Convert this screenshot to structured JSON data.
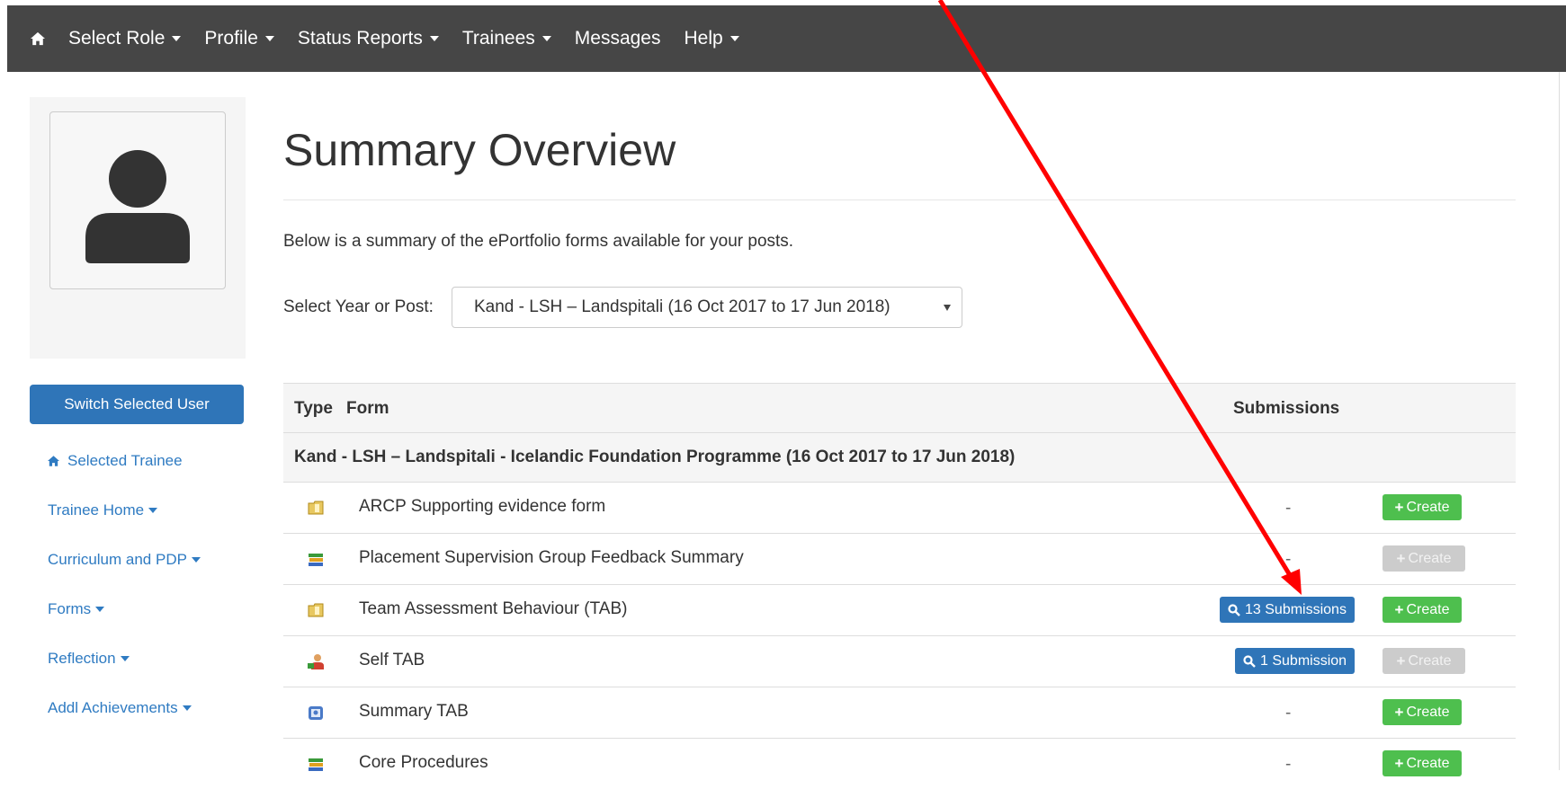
{
  "navbar": {
    "home_icon": "home-icon",
    "items": [
      {
        "label": "Select Role",
        "dropdown": true
      },
      {
        "label": "Profile",
        "dropdown": true
      },
      {
        "label": "Status Reports",
        "dropdown": true
      },
      {
        "label": "Trainees",
        "dropdown": true
      },
      {
        "label": "Messages",
        "dropdown": false
      },
      {
        "label": "Help",
        "dropdown": true
      }
    ]
  },
  "sidebar": {
    "avatar_icon": "user-silhouette-icon",
    "switch_button": "Switch Selected User",
    "selected_trainee": "Selected Trainee",
    "links": [
      {
        "label": "Trainee Home"
      },
      {
        "label": "Curriculum and PDP"
      },
      {
        "label": "Forms"
      },
      {
        "label": "Reflection"
      },
      {
        "label": "Addl Achievements"
      }
    ]
  },
  "main": {
    "title": "Summary Overview",
    "intro": "Below is a summary of the ePortfolio forms available for your posts.",
    "select_label": "Select Year or Post:",
    "select_value": "Kand - LSH – Landspitali (16 Oct 2017 to 17 Jun 2018)",
    "table": {
      "headers": {
        "type": "Type",
        "form": "Form",
        "submissions": "Submissions"
      },
      "group": "Kand - LSH – Landspitali - Icelandic Foundation Programme (16 Oct 2017 to 17 Jun 2018)",
      "rows": [
        {
          "icon": "folder-icon",
          "name": "ARCP Supporting evidence form",
          "submissions": "-",
          "create": "Create",
          "create_enabled": true
        },
        {
          "icon": "books-icon",
          "name": "Placement Supervision Group Feedback Summary",
          "submissions": "-",
          "create": "Create",
          "create_enabled": false
        },
        {
          "icon": "folder-icon",
          "name": "Team Assessment Behaviour (TAB)",
          "submissions": "13 Submissions",
          "create": "Create",
          "create_enabled": true
        },
        {
          "icon": "person-icon",
          "name": "Self TAB",
          "submissions": "1 Submission",
          "create": "Create",
          "create_enabled": false
        },
        {
          "icon": "summary-icon",
          "name": "Summary TAB",
          "submissions": "-",
          "create": "Create",
          "create_enabled": true
        },
        {
          "icon": "books-icon",
          "name": "Core Procedures",
          "submissions": "-",
          "create": "Create",
          "create_enabled": true
        }
      ]
    }
  },
  "colors": {
    "navbar_bg": "#464646",
    "primary_blue": "#2f75b8",
    "link_blue": "#2f7bc2",
    "create_green": "#4ebf4e",
    "disabled_grey": "#cccccc",
    "annotation_red": "#ff0000"
  }
}
